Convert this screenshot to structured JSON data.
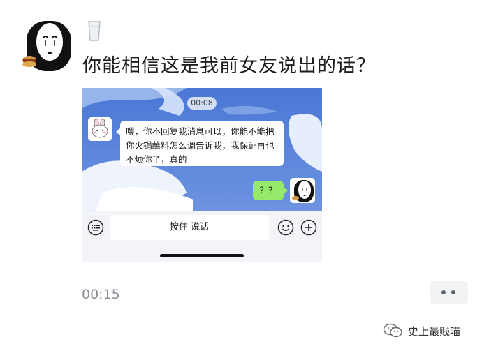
{
  "post": {
    "title": "你能相信这是我前女友说出的话？",
    "duration": "00:15"
  },
  "chat": {
    "time": "00:08",
    "incoming_message": "喂，你不回复我消息可以，你能不能把你火锅蘸料怎么调告诉我，我保证再也不烦你了，真的",
    "outgoing_message": "？？",
    "hold_to_talk_label": "按住 说话"
  },
  "watermark": {
    "text": "史上最贱喵"
  },
  "icons": {
    "post_avatar": "no-face-avatar-icon",
    "cup": "cup-icon",
    "friend_avatar": "bunny-avatar-icon",
    "my_avatar": "no-face-avatar-icon",
    "keyboard": "voice-keyboard-icon",
    "emoji": "emoji-icon",
    "plus": "plus-icon",
    "more": "more-icon",
    "wechat": "wechat-logo-icon"
  }
}
